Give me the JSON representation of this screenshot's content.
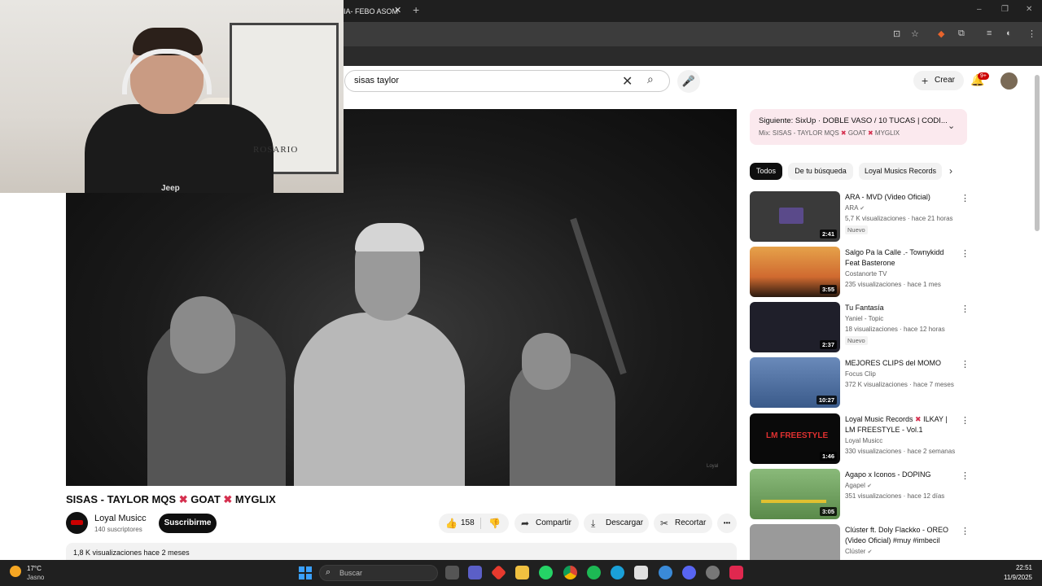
{
  "browser": {
    "tab_title": "IA- FEBO ASOM",
    "tab_close": "✕",
    "tab_new": "+",
    "window_controls": [
      "–",
      "❐",
      "✕"
    ]
  },
  "youtube": {
    "search": {
      "value": "sisas  taylor",
      "clear": "✕",
      "search_icon": "⌕"
    },
    "mic": "🎤",
    "create_label": "Crear",
    "create_plus": "+",
    "notifications_badge": "9+",
    "bell": "🔔"
  },
  "webcam": {
    "map_label": "ROSARIO",
    "shirt_logo": "Jeep"
  },
  "video": {
    "title_parts": [
      "SISAS - TAYLOR MQS ",
      "✖",
      " GOAT ",
      "✖",
      " MYGLIX"
    ],
    "watermark": "Loyal",
    "channel_name": "Loyal Musicc",
    "subscribers": "140 suscriptores",
    "subscribe_label": "Suscribirme",
    "likes": "158",
    "share_label": "Compartir",
    "download_label": "Descargar",
    "clip_label": "Recortar",
    "more_label": "•••",
    "description": "1,8 K visualizaciones  hace 2 meses"
  },
  "up_next": {
    "title": "Siguiente: SixUp · DOBLE VASO / 10 TUCAS | CODI...",
    "subtitle_parts": [
      "Mix: SISAS - TAYLOR MQS ",
      "✖",
      " GOAT ",
      "✖",
      " MYGLIX"
    ]
  },
  "chips": [
    "Todos",
    "De tu búsqueda",
    "Loyal Musics Records"
  ],
  "recommendations": [
    {
      "title": "ARA - MVD (Video Oficial)",
      "channel": "ARA",
      "verified": true,
      "meta": "5,7 K visualizaciones · hace 21 horas",
      "badge": "Nuevo",
      "duration": "2:41",
      "thumb_color": "#3a3a3a"
    },
    {
      "title": "Salgo Pa la Calle .- Townykidd Feat Basterone",
      "channel": "Costanorte TV",
      "verified": false,
      "meta": "235 visualizaciones · hace 1 mes",
      "badge": "",
      "duration": "3:55",
      "thumb_color": "#d9863a"
    },
    {
      "title": "Tu Fantasía",
      "channel": "Yaniel - Topic",
      "verified": false,
      "meta": "18 visualizaciones · hace 12 horas",
      "badge": "Nuevo",
      "duration": "2:37",
      "thumb_color": "#1f1f2a"
    },
    {
      "title": "MEJORES CLIPS del MOMO",
      "channel": "Focus Clip",
      "verified": false,
      "meta": "372 K visualizaciones · hace 7 meses",
      "badge": "",
      "duration": "10:27",
      "thumb_color": "#4a6a9a"
    },
    {
      "title_parts": [
        "Loyal Music Records ",
        "✖",
        " ILKAY | LM FREESTYLE - Vol.1"
      ],
      "channel": "Loyal Musicc",
      "verified": false,
      "meta": "330 visualizaciones · hace 2 semanas",
      "badge": "",
      "duration": "1:46",
      "thumb_color": "#0a0a0a",
      "thumb_text": "LM FREESTYLE"
    },
    {
      "title": "Agapo x Iconos  - DOPING",
      "channel": "Agapel",
      "verified": true,
      "meta": "351 visualizaciones · hace 12 días",
      "badge": "",
      "duration": "3:05",
      "thumb_color": "#6a9a5a"
    },
    {
      "title": "Clúster ft. Doly Flackko - OREO (Video Oficial) #muy #imbecil",
      "channel": "Clúster",
      "verified": true,
      "meta": "",
      "badge": "",
      "duration": "",
      "thumb_color": "#8a8a8a"
    }
  ],
  "taskbar": {
    "temperature": "17°C",
    "weather": "Jasno",
    "search_placeholder": "Buscar",
    "time": "22:51",
    "date": "11/9/2025"
  }
}
